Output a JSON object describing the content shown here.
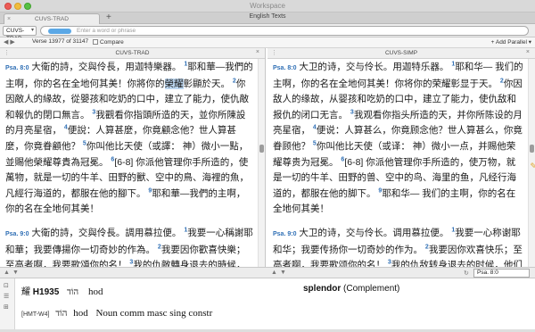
{
  "window": {
    "title": "Workspace",
    "subtitle": "English Texts"
  },
  "tabs": [
    {
      "label": "CUVS-TRAD"
    }
  ],
  "toolbar": {
    "translation": "CUVS-TRAD",
    "search_placeholder": "Enter a word or phrase"
  },
  "nav": {
    "verse_info": "Verse 13977 of 31147",
    "compare_label": "Compare",
    "add_parallel": "Add Parallel"
  },
  "panes": {
    "left": {
      "title": "CUVS-TRAD",
      "p1": {
        "ref": "Psa. 8:0",
        "v0": "大衛的詩，交與伶長，用迦特樂器。",
        "n1": "1",
        "v1a": "耶和華—我們的主啊，你的名在全地何其美！你將你的",
        "hl": "榮耀",
        "v1b": "彰顯於天。",
        "n2": "2",
        "v2": "你因敵人的緣故，從嬰孩和吃奶的口中，建立了能力，使仇敵和報仇的閉口無言。",
        "n3": "3",
        "v3": "我觀看你指頭所造的天，並你所陳設的月亮星宿，",
        "n4": "4",
        "v4": "便說：人算甚麼，你竟顧念他？世人算甚麼，你竟眷顧他？",
        "n5": "5",
        "v5": "你叫他比天使（或譯： 神）微小一點，並賜他榮耀尊貴為冠冕。",
        "n6": "6",
        "v6": "[6-8] 你派他管理你手所造的，使萬物，就是一切的牛羊、田野的獸、空中的鳥、海裡的魚，凡經行海道的，都服在他的腳下。",
        "n9": "9",
        "v9": "耶和華—我們的主啊，你的名在全地何其美！"
      },
      "p2": {
        "ref": "Psa. 9:0",
        "v0": "大衛的詩，交與伶長。調用慕拉便。",
        "n1": "1",
        "v1": "我要一心稱謝耶和華；我要傳揚你一切奇妙的作為。",
        "n2": "2",
        "v2": "我要因你歡喜快樂；至高者啊，我要歌頌你的名！",
        "n3": "3",
        "v3": "我的仇敵轉身退去的時候，他們一見你"
      }
    },
    "right": {
      "title": "CUVS-SIMP",
      "p1": {
        "ref": "Psa. 8:0",
        "v0": "大卫的诗，交与伶长。用迦特乐器。",
        "n1": "1",
        "v1": "耶和华— 我们的主啊，你的名在全地何其美！你将你的荣耀彰显于天。",
        "n2": "2",
        "v2": "你因敌人的缘故，从婴孩和吃奶的口中，建立了能力，使仇敌和报仇的闭口无言。",
        "n3": "3",
        "v3": "我观看你指头所造的天，并你所陈设的月亮星宿，",
        "n4": "4",
        "v4": "便说：人算甚么，你竟顾念他？世人算甚么，你竟眷顾他？",
        "n5": "5",
        "v5": "你叫他比天使（或译： 神）微小一点，并赐他荣耀尊贵为冠冕。",
        "n6": "6",
        "v6": "[6-8] 你派他管理你手所造的，使万物，就是一切的牛羊、田野的兽、空中的鸟、海里的鱼，凡经行海道的，都服在他的脚下。",
        "n9": "9",
        "v9": "耶和华— 我们的主啊，你的名在全地何其美！"
      },
      "p2": {
        "ref": "Psa. 9:0",
        "v0": "大卫的诗，交与伶长。调用慕拉便。",
        "n1": "1",
        "v1": "我要一心称谢耶和华；我要传扬你一切奇妙的作为。",
        "n2": "2",
        "v2": "我要因你欢喜快乐；至高者啊，我要歌颂你的名！",
        "n3": "3",
        "v3": "我的仇敌转身退去的时候，他们一见你"
      }
    }
  },
  "footer": {
    "ref": "Psa. 8:0"
  },
  "info": {
    "hanzi": "耀",
    "strong": "H1935",
    "hebrew": "הוֹד",
    "translit": "hod",
    "gloss_word": "splendor",
    "gloss_role": "(Complement)",
    "morph_code": "[HMT-W4]",
    "parse": "Noun comm masc sing constr"
  },
  "colors": {
    "accent": "#2f6fb5",
    "highlight": "#bcd6ef",
    "search_pill": "#5ba8e6"
  }
}
